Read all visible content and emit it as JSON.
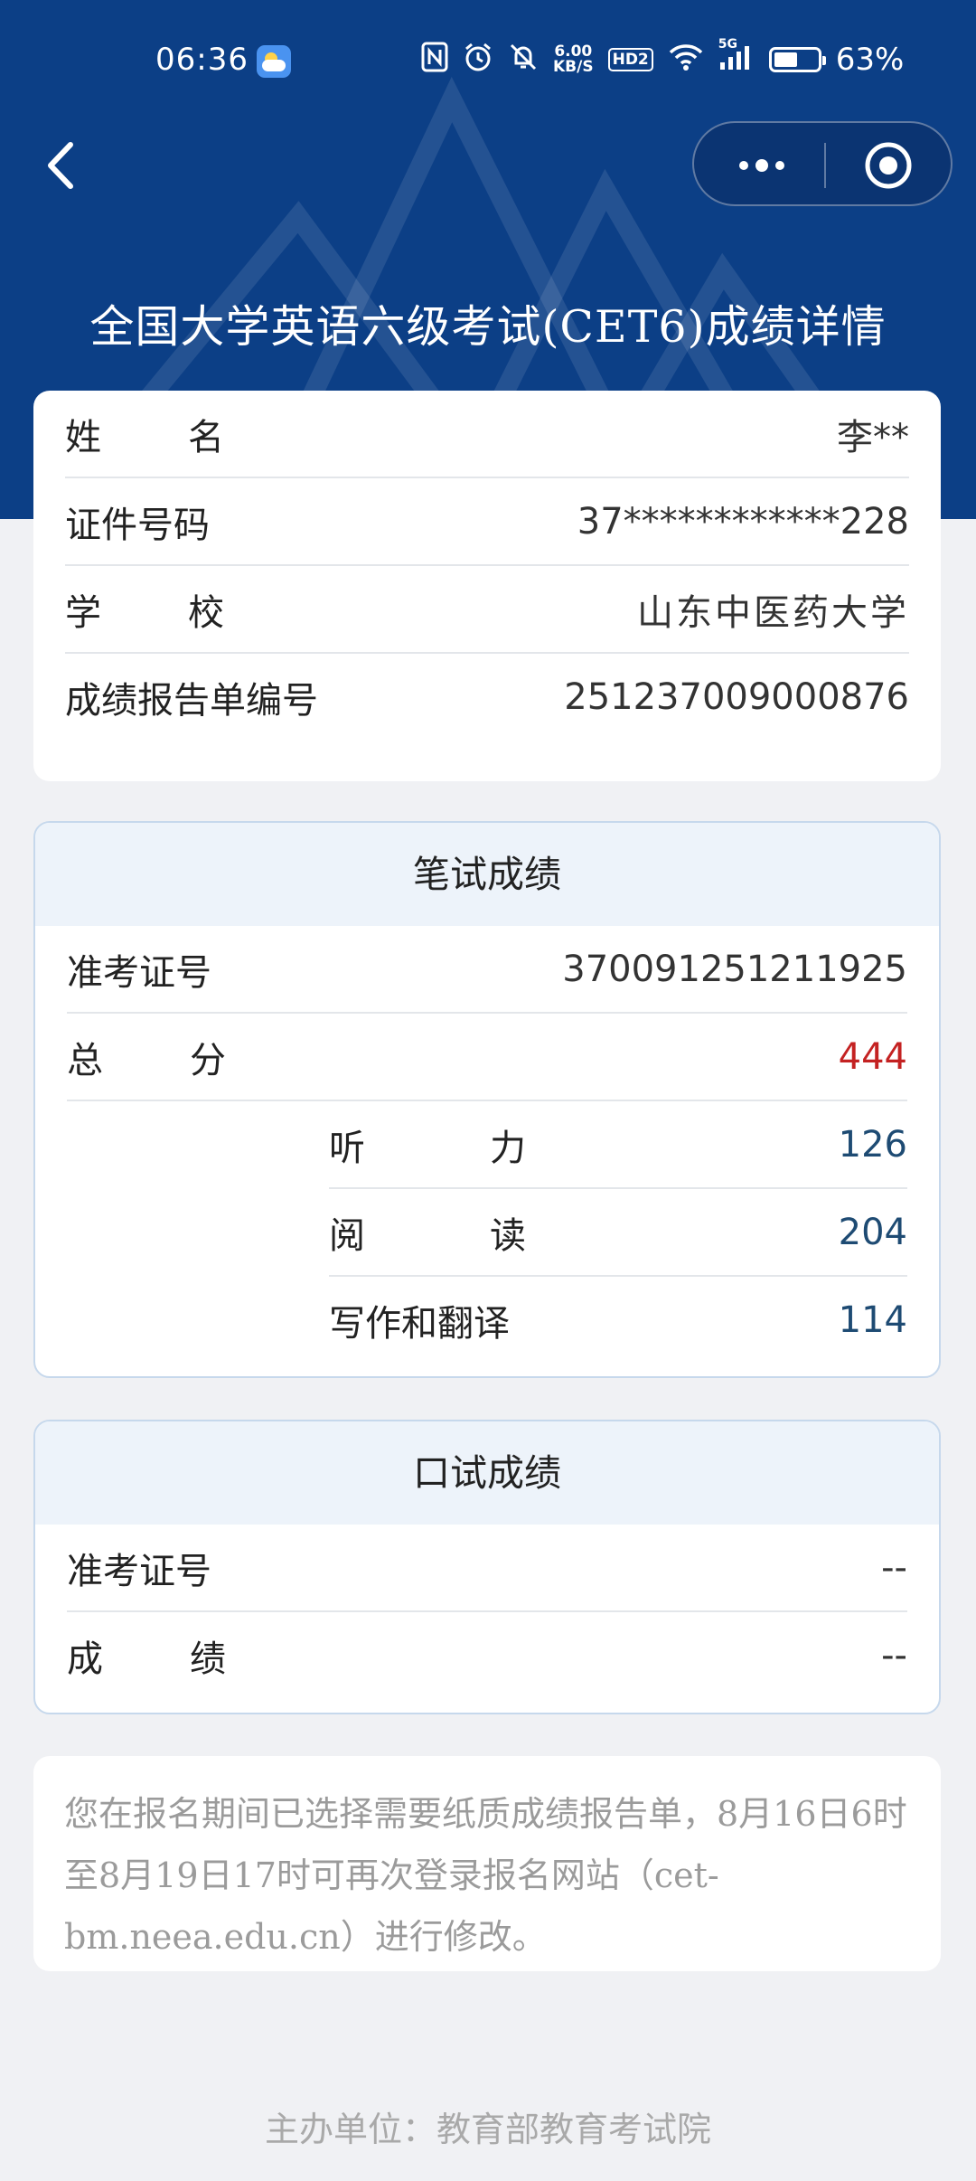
{
  "status_bar": {
    "time": "06:36",
    "net_speed_value": "6.00",
    "net_speed_unit": "KB/S",
    "hd_label": "HD2",
    "signal_label": "5G",
    "battery_percent": 63,
    "battery_text": "63%"
  },
  "page_title": "全国大学英语六级考试(CET6)成绩详情",
  "personal_info": {
    "rows": [
      {
        "label": "姓名",
        "value": "李**"
      },
      {
        "label": "证件号码",
        "value": "37************228"
      },
      {
        "label": "学校",
        "value": "山东中医药大学"
      },
      {
        "label": "成绩报告单编号",
        "value": "251237009000876"
      }
    ]
  },
  "written_exam": {
    "title": "笔试成绩",
    "ticket_label": "准考证号",
    "ticket_value": "370091251211925",
    "total_label": "总分",
    "total_value": "444",
    "sections": [
      {
        "label": "听力",
        "value": "126"
      },
      {
        "label": "阅读",
        "value": "204"
      },
      {
        "label": "写作和翻译",
        "value": "114"
      }
    ]
  },
  "oral_exam": {
    "title": "口试成绩",
    "ticket_label": "准考证号",
    "ticket_value": "--",
    "score_label": "成绩",
    "score_value": "--"
  },
  "notice": "您在报名期间已选择需要纸质成绩报告单，8月16日6时至8月19日17时可再次登录报名网站（cet-bm.neea.edu.cn）进行修改。",
  "footer": "主办单位：教育部教育考试院",
  "colors": {
    "header_bg": "#0c3f86",
    "total_score": "#c42222",
    "section_score": "#1e4b73"
  }
}
